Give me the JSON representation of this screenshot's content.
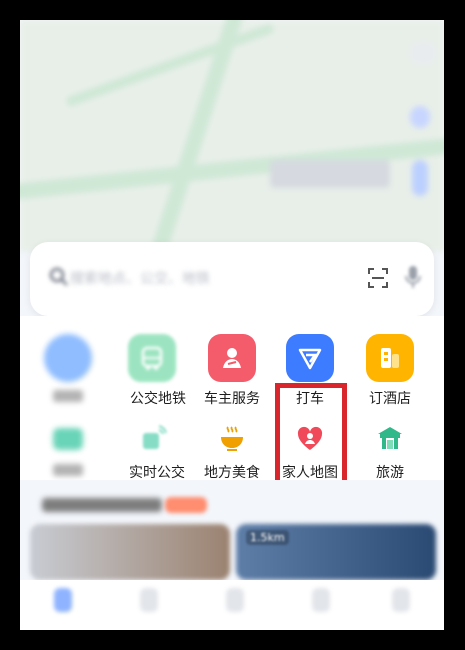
{
  "search": {
    "placeholder": "搜索地点、公交、地铁"
  },
  "grid": {
    "row1": [
      {
        "name": "bus-subway",
        "label": "公交地铁",
        "color": "#4ccf8f"
      },
      {
        "name": "car-owner",
        "label": "车主服务",
        "color": "#f45b6b"
      },
      {
        "name": "taxi",
        "label": "打车",
        "color": "#3d7bff"
      },
      {
        "name": "hotel",
        "label": "订酒店",
        "color": "#ffb400"
      }
    ],
    "row2": [
      {
        "name": "realtime-bus",
        "label": "实时公交",
        "color": "#37c6a0"
      },
      {
        "name": "local-food",
        "label": "地方美食",
        "color": "#f0a000"
      },
      {
        "name": "family-map",
        "label": "家人地图",
        "color": "#f04a5a"
      },
      {
        "name": "travel",
        "label": "旅游",
        "color": "#31b88a"
      }
    ]
  },
  "cards": {
    "distance": "1.5km"
  },
  "colors": {
    "highlight": "#d8262c"
  }
}
